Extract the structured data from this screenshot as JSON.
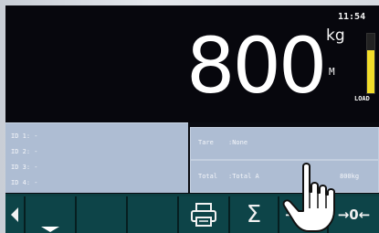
{
  "status": {
    "clock": "11:54"
  },
  "weight": {
    "value": "800",
    "unit": "kg",
    "motion": "M",
    "load_label": "LOAD",
    "load_level": 0.72
  },
  "ids": [
    {
      "label": "ID 1: -"
    },
    {
      "label": "ID 2: -"
    },
    {
      "label": "ID 3: -"
    },
    {
      "label": "ID 4: -"
    }
  ],
  "tare": {
    "label": "Tare",
    "value": ":None"
  },
  "total": {
    "label": "Total",
    "value": ":Total A",
    "amount": "800kg"
  },
  "softkeys": {
    "zero_label": "→0←",
    "partial_label": "→"
  },
  "colors": {
    "display_bg": "#07070d",
    "info_panel": "#aebdd3",
    "softkey_bar": "#0c3f42",
    "load_fill": "#f2dd2a"
  },
  "icons": {
    "scroll_left": "triangle-left-icon",
    "down": "triangle-down-icon",
    "print": "printer-icon",
    "sum": "sigma-icon",
    "hand": "pointing-hand-icon"
  }
}
